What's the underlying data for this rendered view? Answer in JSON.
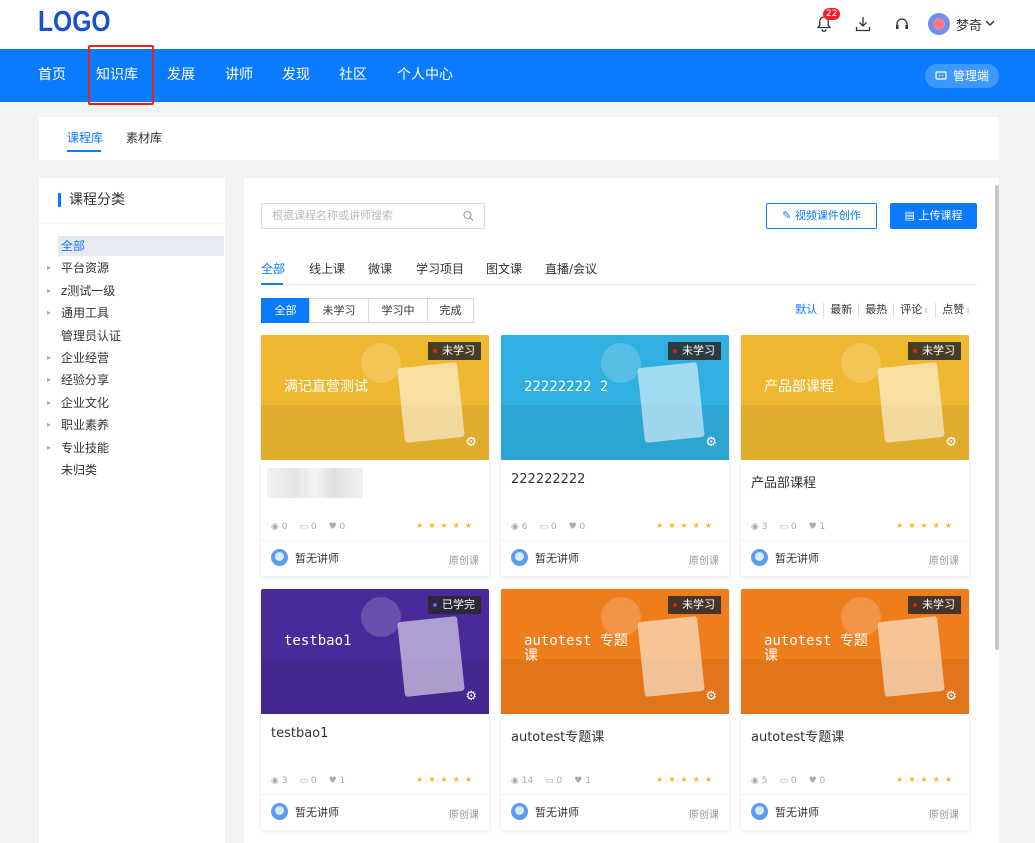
{
  "header": {
    "logo": "LOGO",
    "notification_count": "22",
    "user_name": "梦奇"
  },
  "nav": {
    "items": [
      "首页",
      "知识库",
      "发展",
      "讲师",
      "发现",
      "社区",
      "个人中心"
    ],
    "management": "管理端"
  },
  "subtabs": [
    "课程库",
    "素材库"
  ],
  "sidebar": {
    "title": "课程分类",
    "items": [
      {
        "label": "全部",
        "expandable": false,
        "active": true
      },
      {
        "label": "平台资源",
        "expandable": true
      },
      {
        "label": "z测试一级",
        "expandable": true
      },
      {
        "label": "通用工具",
        "expandable": true
      },
      {
        "label": "管理员认证",
        "expandable": false
      },
      {
        "label": "企业经营",
        "expandable": true
      },
      {
        "label": "经验分享",
        "expandable": true
      },
      {
        "label": "企业文化",
        "expandable": true
      },
      {
        "label": "职业素养",
        "expandable": true
      },
      {
        "label": "专业技能",
        "expandable": true
      },
      {
        "label": "未归类",
        "expandable": false
      }
    ]
  },
  "toolbar": {
    "search_placeholder": "根据课程名称或讲师搜索",
    "create_video": "视频课件创作",
    "upload": "上传课程"
  },
  "content_tabs": [
    "全部",
    "线上课",
    "微课",
    "学习项目",
    "图文课",
    "直播/会议"
  ],
  "filters": [
    "全部",
    "未学习",
    "学习中",
    "完成"
  ],
  "sorts": [
    "默认",
    "最新",
    "最热",
    "评论",
    "点赞"
  ],
  "cards": [
    {
      "cover_text": "满记直营测试",
      "status": "未学习",
      "title": "",
      "views": "0",
      "comments": "0",
      "likes": "0",
      "teacher": "暂无讲师",
      "type": "原创课",
      "cover_color": "#f0b731"
    },
    {
      "cover_text": "22222222 2",
      "status": "未学习",
      "title": "222222222",
      "views": "6",
      "comments": "0",
      "likes": "0",
      "teacher": "暂无讲师",
      "type": "原创课",
      "cover_color": "#2fb0e0"
    },
    {
      "cover_text": "产品部课程",
      "status": "未学习",
      "title": "产品部课程",
      "views": "3",
      "comments": "0",
      "likes": "1",
      "teacher": "暂无讲师",
      "type": "原创课",
      "cover_color": "#f0b731"
    },
    {
      "cover_text": "testbao1",
      "status": "已学完",
      "title": "testbao1",
      "views": "3",
      "comments": "0",
      "likes": "1",
      "teacher": "暂无讲师",
      "type": "原创课",
      "cover_color": "#4a2a9a"
    },
    {
      "cover_text": "autotest 专题课",
      "status": "未学习",
      "title": "autotest专题课",
      "views": "14",
      "comments": "0",
      "likes": "1",
      "teacher": "暂无讲师",
      "type": "原创课",
      "cover_color": "#ee7d1c"
    },
    {
      "cover_text": "autotest 专题课",
      "status": "未学习",
      "title": "autotest专题课",
      "views": "5",
      "comments": "0",
      "likes": "0",
      "teacher": "暂无讲师",
      "type": "原创课",
      "cover_color": "#ee7d1c"
    }
  ]
}
